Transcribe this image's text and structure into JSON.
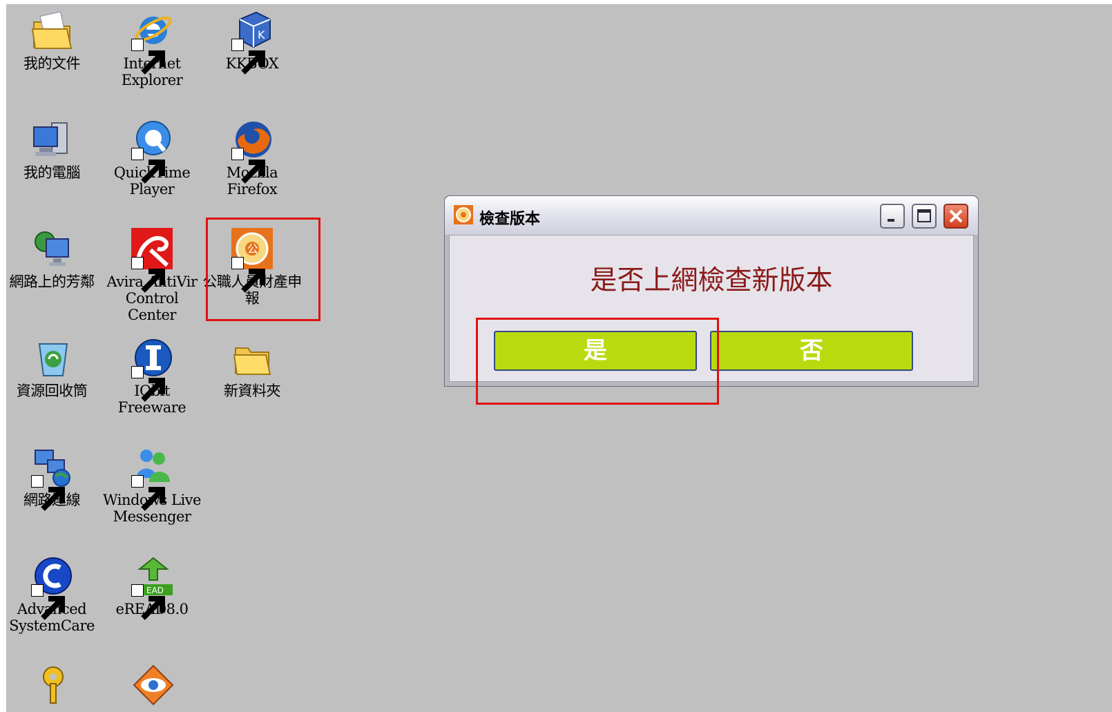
{
  "desktop": {
    "background": "#c0c0c0",
    "icons": [
      {
        "label": "我的文件",
        "icon": "my-documents-icon"
      },
      {
        "label": "Internet Explorer",
        "icon": "internet-explorer-icon"
      },
      {
        "label": "KKBOX",
        "icon": "kkbox-icon"
      },
      {
        "label": "我的電腦",
        "icon": "my-computer-icon"
      },
      {
        "label": "QuickTime Player",
        "icon": "quicktime-icon"
      },
      {
        "label": "Mozilla Firefox",
        "icon": "firefox-icon"
      },
      {
        "label": "網路上的芳鄰",
        "icon": "network-places-icon"
      },
      {
        "label": "Avira AntiVir Control Center",
        "icon": "avira-icon"
      },
      {
        "label": "公職人員財產申報",
        "icon": "property-declaration-icon"
      },
      {
        "label": "資源回收筒",
        "icon": "recycle-bin-icon"
      },
      {
        "label": "IObit Freeware",
        "icon": "iobit-icon"
      },
      {
        "label": "新資料夾",
        "icon": "folder-icon"
      },
      {
        "label": "網路連線",
        "icon": "network-connections-icon"
      },
      {
        "label": "Windows Live Messenger",
        "icon": "messenger-icon"
      },
      {
        "label": "Advanced SystemCare",
        "icon": "advanced-systemcare-icon"
      },
      {
        "label": "eREAD8.0",
        "icon": "eread-icon"
      }
    ]
  },
  "dialog": {
    "title": "檢查版本",
    "message": "是否上網檢查新版本",
    "yes_label": "是",
    "no_label": "否",
    "button_color": "#bada10",
    "message_color": "#8b1a1a"
  },
  "highlight_color": "#e01010"
}
